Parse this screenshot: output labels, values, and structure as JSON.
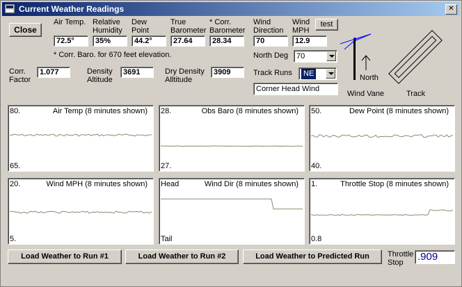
{
  "window": {
    "title": "Current Weather Readings"
  },
  "buttons": {
    "close": "Close",
    "test": "test",
    "load_run1": "Load Weather to Run #1",
    "load_run2": "Load Weather to Run #2",
    "load_predicted": "Load Weather to Predicted Run"
  },
  "readings": {
    "air_temp": {
      "label1": "Air Temp.",
      "label2": "",
      "value": "72.5°"
    },
    "humidity": {
      "label1": "Relative",
      "label2": "Humidity",
      "value": "35%"
    },
    "dew_point": {
      "label1": "Dew",
      "label2": "Point",
      "value": "44.2°"
    },
    "true_baro": {
      "label1": "True",
      "label2": "Barometer",
      "value": "27.64"
    },
    "corr_baro": {
      "label1": "* Corr.",
      "label2": "Barometer",
      "value": "28.34"
    },
    "wind_dir": {
      "label1": "Wind",
      "label2": "Direction",
      "value": "70"
    },
    "wind_mph": {
      "label1": "Wind",
      "label2": "MPH",
      "value": "12.9"
    }
  },
  "note": "* Corr. Baro. for 670 feet elevation.",
  "corr_factor": {
    "label1": "Corr.",
    "label2": "Factor",
    "value": "1.077"
  },
  "density_alt": {
    "label1": "Density",
    "label2": "Altitude",
    "value": "3691"
  },
  "dry_density_alt": {
    "label1": "Dry Density",
    "label2": "Alltitude",
    "value": "3909"
  },
  "north_deg": {
    "label": "North Deg",
    "value": "70"
  },
  "track_runs": {
    "label": "Track Runs",
    "value": "NE"
  },
  "wind_status": "Corner Head Wind",
  "diagram": {
    "north_label": "North",
    "vane_label": "Wind Vane",
    "track_label": "Track"
  },
  "throttle_stop": {
    "label1": "Throttle",
    "label2": "Stop",
    "value": ".909"
  },
  "graphs": [
    {
      "id": "air-temp",
      "title": "Air Temp (8 minutes shown)",
      "max": "80.",
      "min": "65.",
      "level": 0.4,
      "noise": 1.5,
      "step": null
    },
    {
      "id": "obs-baro",
      "title": "Obs Baro (8 minutes shown)",
      "max": "28.",
      "min": "27.",
      "level": 0.64,
      "noise": 0.3,
      "step": null
    },
    {
      "id": "dew-point",
      "title": "Dew Point (8 minutes shown)",
      "max": "50.",
      "min": "40.",
      "level": 0.42,
      "noise": 2.0,
      "step": null
    },
    {
      "id": "wind-mph",
      "title": "Wind MPH (8 minutes shown)",
      "max": "20.",
      "min": "5.",
      "level": 0.49,
      "noise": 1.4,
      "step": null
    },
    {
      "id": "wind-dir",
      "title": "Wind Dir (8 minutes shown)",
      "max": "Head",
      "min": "Tail",
      "level": 0.2,
      "noise": 0,
      "step": {
        "at": 0.78,
        "level": 0.42
      }
    },
    {
      "id": "throttle-stop",
      "title": "Throttle Stop (8 minutes shown)",
      "max": "1.",
      "min": "0.8",
      "level": 0.55,
      "noise": 0.8,
      "step": {
        "at": 0.82,
        "level": 0.45
      }
    }
  ]
}
